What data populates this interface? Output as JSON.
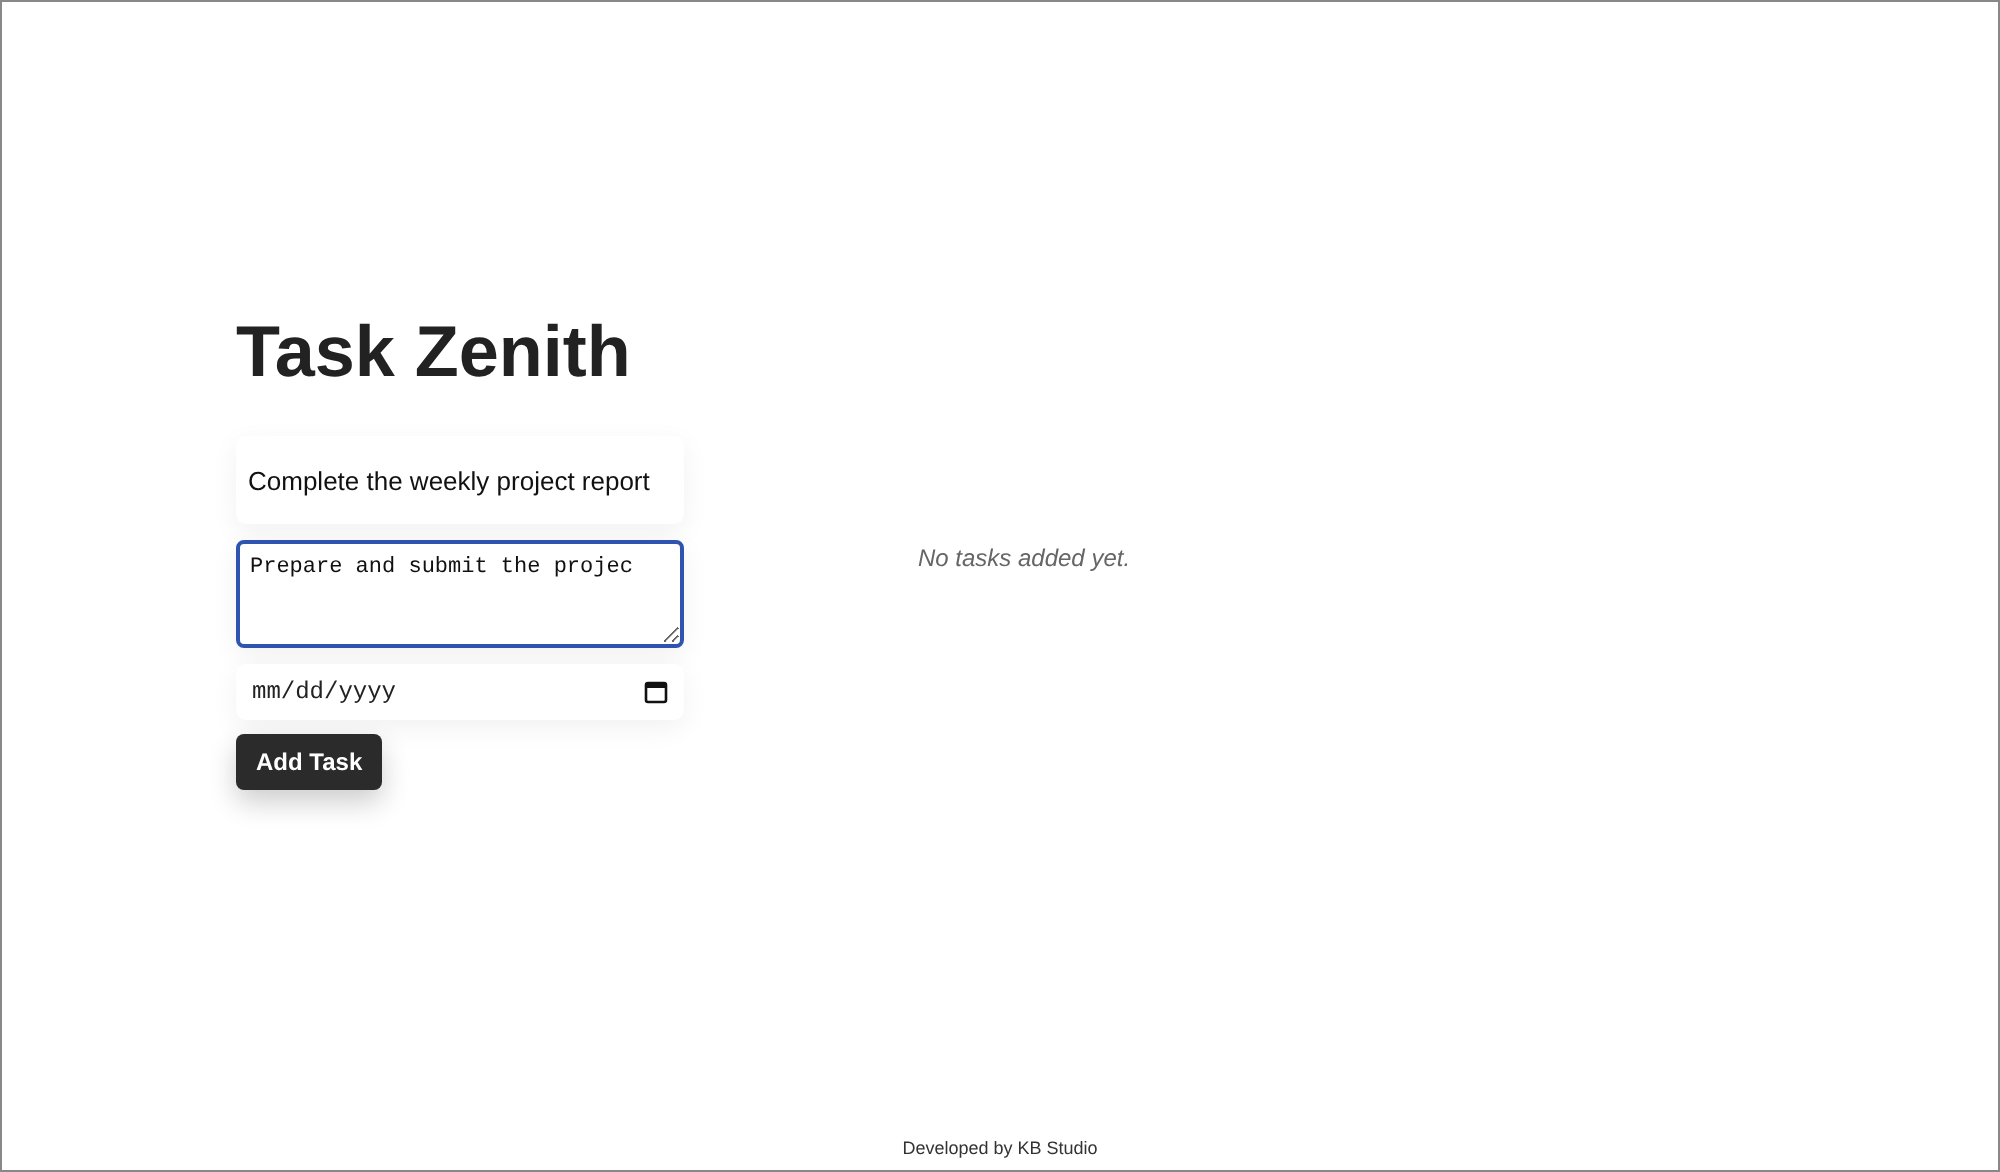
{
  "title": "Task Zenith",
  "form": {
    "title_field": {
      "value": "Complete the weekly project report"
    },
    "description_field": {
      "value": "Prepare and submit the projec"
    },
    "date_field": {
      "placeholder": "mm/dd/yyyy"
    },
    "submit_button": "Add Task"
  },
  "task_list": {
    "empty_message": "No tasks added yet."
  },
  "footer": "Developed by KB Studio"
}
